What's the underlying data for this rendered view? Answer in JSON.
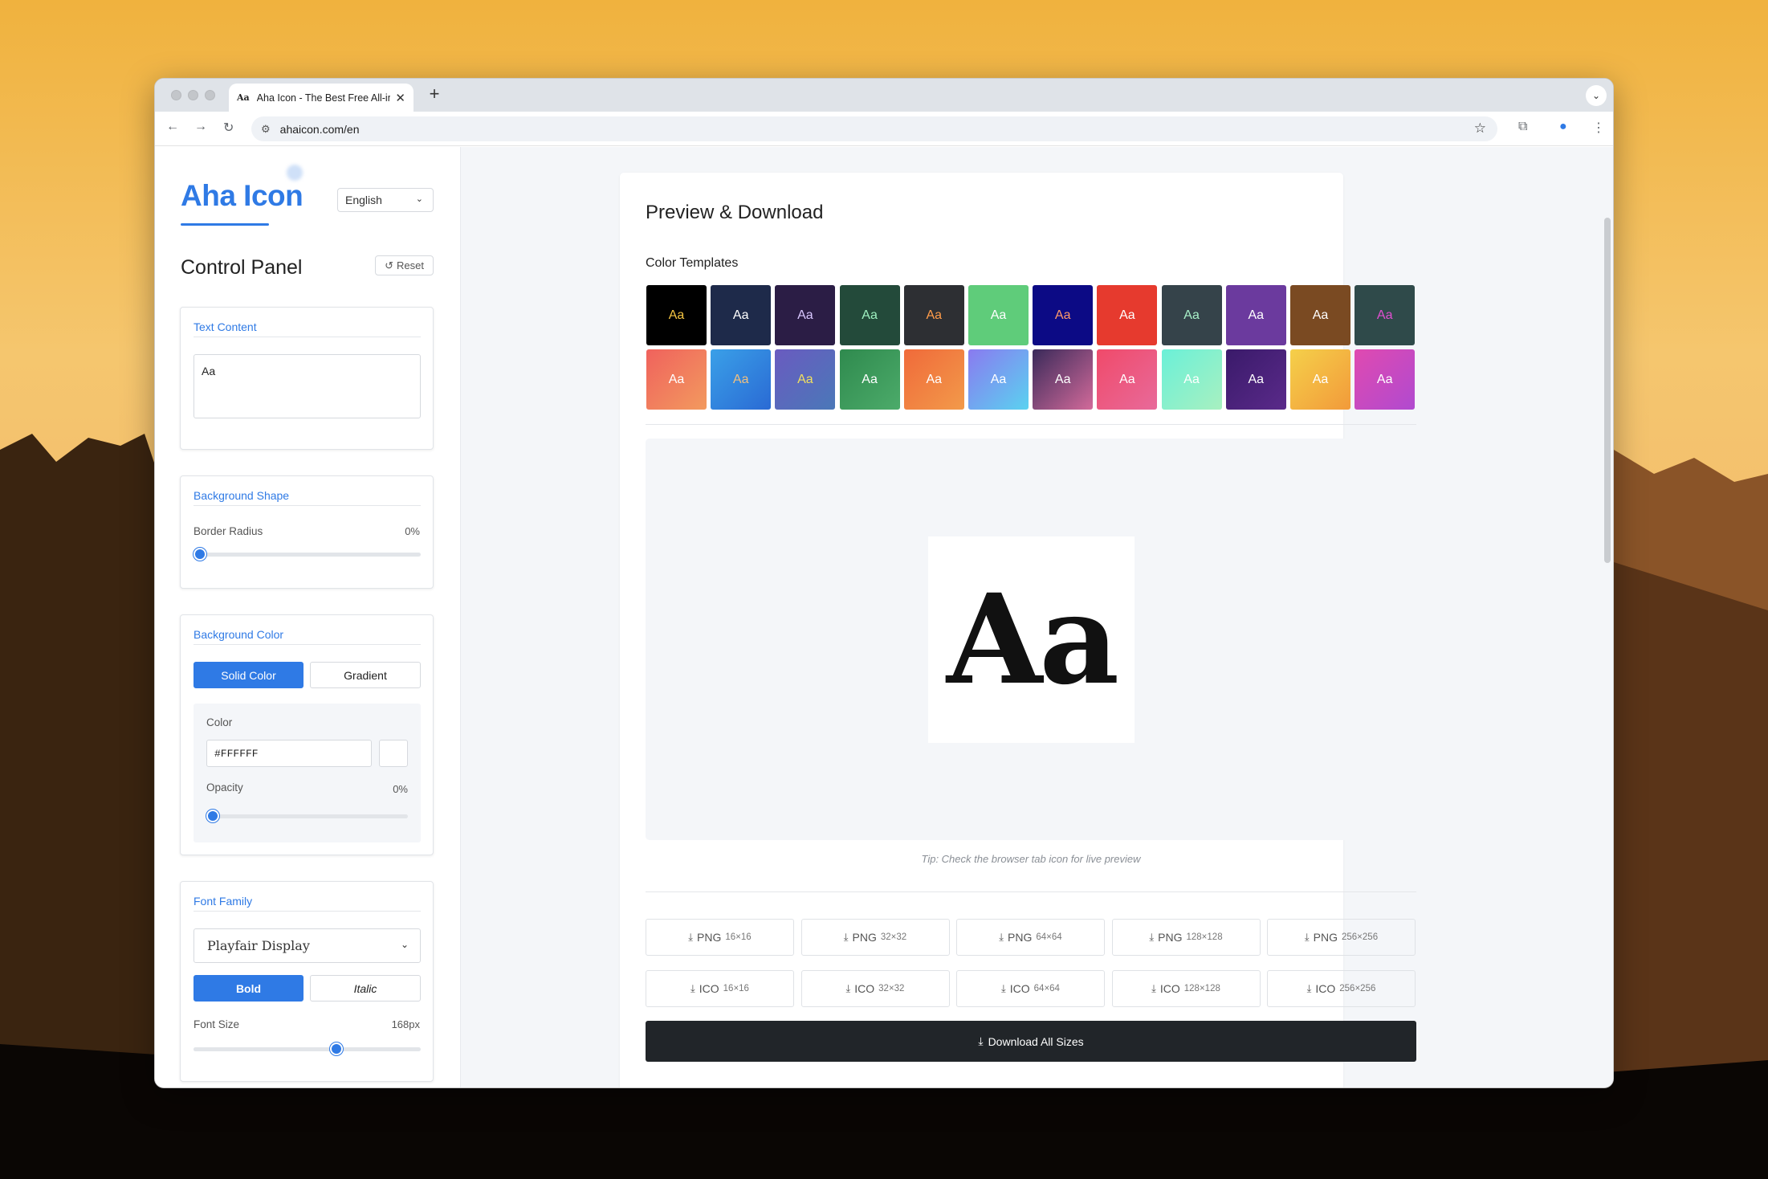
{
  "colors": {
    "accent": "#2f7ae5",
    "dark_button": "#212529"
  },
  "browser": {
    "tab_favicon": "Aa",
    "tab_title": "Aha Icon - The Best Free All-in-One Icon Generator",
    "tab_close": "✕",
    "new_tab": "+",
    "url_text": "ahaicon.com/en"
  },
  "sidebar": {
    "logo": "Aha Icon",
    "language": "English",
    "panel_title": "Control Panel",
    "reset_label": "Reset",
    "text_content": {
      "title": "Text Content",
      "value": "Aa"
    },
    "background_shape": {
      "title": "Background Shape",
      "border_radius_label": "Border Radius",
      "border_radius_value": "0%",
      "border_radius_fraction": 0.0
    },
    "background_color": {
      "title": "Background Color",
      "solid_label": "Solid Color",
      "gradient_label": "Gradient",
      "color_label": "Color",
      "color_value": "#FFFFFF",
      "opacity_label": "Opacity",
      "opacity_value": "0%",
      "opacity_fraction": 0.0
    },
    "font_family": {
      "title": "Font Family",
      "selected_font": "Playfair Display",
      "bold_label": "Bold",
      "italic_label": "Italic",
      "font_size_label": "Font Size",
      "font_size_value": "168px",
      "font_size_fraction": 0.63
    }
  },
  "main": {
    "title": "Preview & Download",
    "templates_title": "Color Templates",
    "templates": [
      {
        "label": "Aa",
        "bg": "#000000",
        "fg": "#f5c542"
      },
      {
        "label": "Aa",
        "bg": "#1e2a4a",
        "fg": "#ffffff"
      },
      {
        "label": "Aa",
        "bg": "#2b1d45",
        "fg": "#d9c7ff"
      },
      {
        "label": "Aa",
        "bg": "#234a3a",
        "fg": "#9ef0c0"
      },
      {
        "label": "Aa",
        "bg": "#2d2f33",
        "fg": "#ff9c4a"
      },
      {
        "label": "Aa",
        "bg": "#5fcc7a",
        "fg": "#ffffff"
      },
      {
        "label": "Aa",
        "bg": "#0c0a85",
        "fg": "#ff9a6a"
      },
      {
        "label": "Aa",
        "bg": "#e63a2e",
        "fg": "#ffffff"
      },
      {
        "label": "Aa",
        "bg": "#35434a",
        "fg": "#a8f0c8"
      },
      {
        "label": "Aa",
        "bg": "#6b3a9e",
        "fg": "#ffffff"
      },
      {
        "label": "Aa",
        "bg": "#7a4a22",
        "fg": "#ffffff"
      },
      {
        "label": "Aa",
        "bg": "#2f4a4a",
        "fg": "#e04fd0"
      },
      {
        "label": "Aa",
        "bg": "linear-gradient(135deg,#f0625d,#f29a5e)",
        "fg": "#ffffff"
      },
      {
        "label": "Aa",
        "bg": "linear-gradient(135deg,#3aa0e8,#2a6ad4)",
        "fg": "#f0c080"
      },
      {
        "label": "Aa",
        "bg": "linear-gradient(135deg,#6a5bc0,#4a78b8)",
        "fg": "#f0e060"
      },
      {
        "label": "Aa",
        "bg": "linear-gradient(135deg,#2f8a4e,#4cab6a)",
        "fg": "#ffffff"
      },
      {
        "label": "Aa",
        "bg": "linear-gradient(135deg,#f06a3a,#f29a4a)",
        "fg": "#ffffff"
      },
      {
        "label": "Aa",
        "bg": "linear-gradient(135deg,#8a7af0,#5ad2f0)",
        "fg": "#ffffff"
      },
      {
        "label": "Aa",
        "bg": "linear-gradient(135deg,#3a2a5a,#d26a9a)",
        "fg": "#ffffff"
      },
      {
        "label": "Aa",
        "bg": "linear-gradient(135deg,#f04a6a,#e86a9a)",
        "fg": "#ffffff"
      },
      {
        "label": "Aa",
        "bg": "linear-gradient(135deg,#6af0d8,#a8f0c0)",
        "fg": "#ffffff"
      },
      {
        "label": "Aa",
        "bg": "linear-gradient(135deg,#3a1a6a,#5a2a8a)",
        "fg": "#ffffff"
      },
      {
        "label": "Aa",
        "bg": "linear-gradient(135deg,#f5d04a,#f29a3a)",
        "fg": "#ffffff"
      },
      {
        "label": "Aa",
        "bg": "linear-gradient(135deg,#e04ab0,#b04ad0)",
        "fg": "#ffffff"
      }
    ],
    "preview_text": "Aa",
    "tip": "Tip: Check the browser tab icon for live preview",
    "png_buttons": [
      {
        "fmt": "PNG",
        "size": "16×16"
      },
      {
        "fmt": "PNG",
        "size": "32×32"
      },
      {
        "fmt": "PNG",
        "size": "64×64"
      },
      {
        "fmt": "PNG",
        "size": "128×128"
      },
      {
        "fmt": "PNG",
        "size": "256×256"
      }
    ],
    "ico_buttons": [
      {
        "fmt": "ICO",
        "size": "16×16"
      },
      {
        "fmt": "ICO",
        "size": "32×32"
      },
      {
        "fmt": "ICO",
        "size": "64×64"
      },
      {
        "fmt": "ICO",
        "size": "128×128"
      },
      {
        "fmt": "ICO",
        "size": "256×256"
      }
    ],
    "download_all_label": "Download All Sizes"
  }
}
